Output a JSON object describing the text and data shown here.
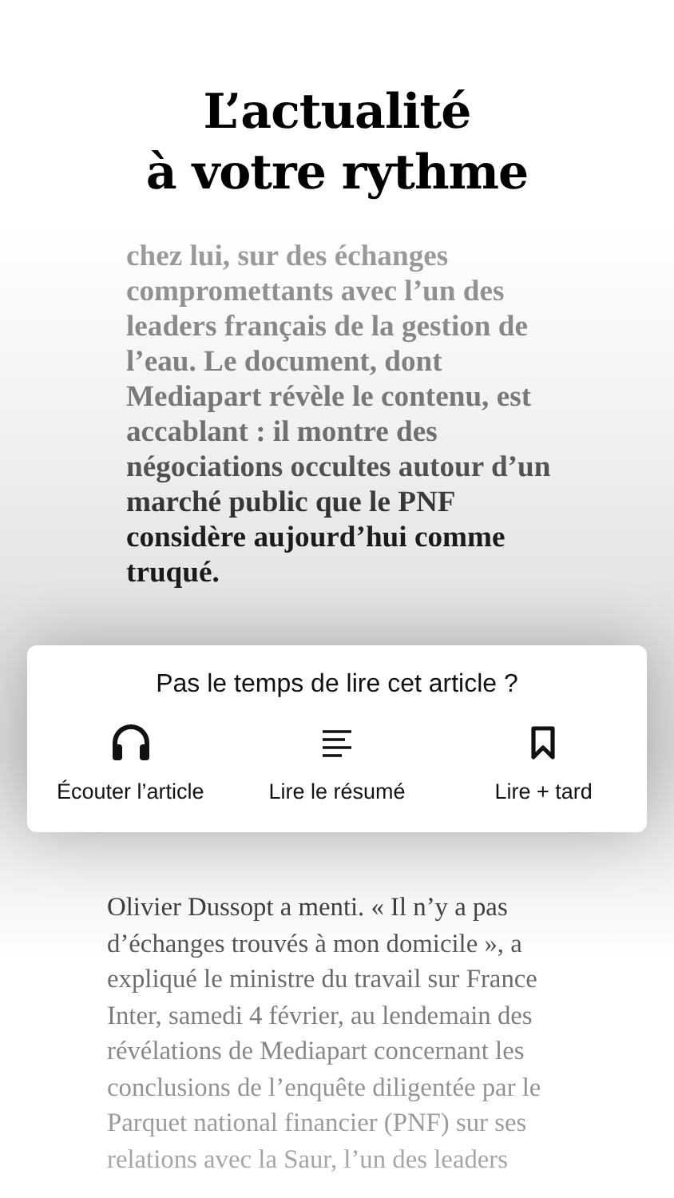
{
  "headline": {
    "lines": [
      "L’actualité",
      "à votre rythme"
    ]
  },
  "article_excerpt": "chez lui, sur des échanges compromettants avec l’un des leaders français de la gestion de l’eau. Le document, dont Mediapart révèle le contenu, est accablant : il montre des négociations occultes autour d’un marché public que le PNF considère aujourd’hui comme truqué.",
  "prompt_card": {
    "title": "Pas le temps de lire cet article ?",
    "actions": [
      {
        "kind": "listen",
        "label": "Écouter l’article"
      },
      {
        "kind": "summary",
        "label": "Lire le résumé"
      },
      {
        "kind": "save",
        "label": "Lire + tard"
      }
    ]
  },
  "article_body": "Olivier Dussopt a menti. « Il n’y a pas d’échanges trouvés à mon domicile », a expliqué le ministre du travail sur France Inter, samedi 4 février, au lendemain des révélations de Mediapart concernant les conclusions de l’enquête diligentée par le Parquet national financier (PNF) sur ses relations avec la Saur, l’un des leaders"
}
